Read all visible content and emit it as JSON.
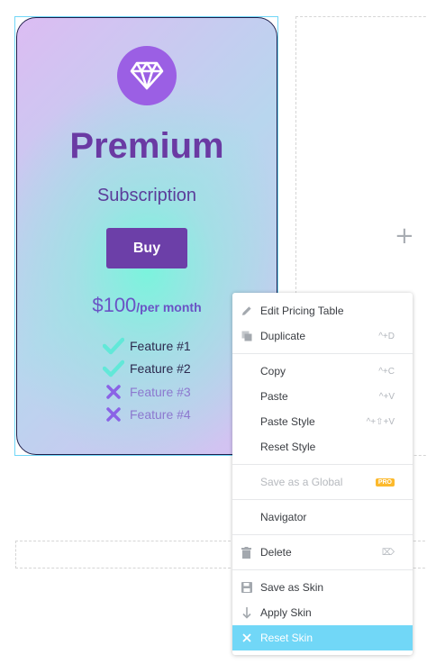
{
  "pricing_card": {
    "title": "Premium",
    "subtitle": "Subscription",
    "button_label": "Buy",
    "price_amount": "$100",
    "price_period": "/per month",
    "features": [
      {
        "label": "Feature #1",
        "included": true
      },
      {
        "label": "Feature #2",
        "included": true
      },
      {
        "label": "Feature #3",
        "included": false
      },
      {
        "label": "Feature #4",
        "included": false
      }
    ],
    "icon": "diamond-icon"
  },
  "empty_column": {
    "add_label": "+"
  },
  "context_menu": {
    "items": [
      {
        "label": "Edit Pricing Table",
        "shortcut": "",
        "icon": "pencil-icon"
      },
      {
        "label": "Duplicate",
        "shortcut": "^+D",
        "icon": "duplicate-icon"
      },
      {
        "label": "Copy",
        "shortcut": "^+C",
        "icon": ""
      },
      {
        "label": "Paste",
        "shortcut": "^+V",
        "icon": ""
      },
      {
        "label": "Paste Style",
        "shortcut": "^+⇧+V",
        "icon": ""
      },
      {
        "label": "Reset Style",
        "shortcut": "",
        "icon": ""
      },
      {
        "label": "Save as a Global",
        "badge": "PRO",
        "disabled": true,
        "icon": ""
      },
      {
        "label": "Navigator",
        "shortcut": "",
        "icon": ""
      },
      {
        "label": "Delete",
        "shortcut": "⌦",
        "icon": "trash-icon"
      },
      {
        "label": "Save as Skin",
        "shortcut": "",
        "icon": "save-icon"
      },
      {
        "label": "Apply Skin",
        "shortcut": "",
        "icon": "arrow-down-icon"
      },
      {
        "label": "Reset Skin",
        "shortcut": "",
        "icon": "close-icon",
        "active": true
      }
    ]
  },
  "colors": {
    "accent": "#71d7f7",
    "brand_purple": "#6c3fa8",
    "pro_badge": "#fcb92c"
  }
}
